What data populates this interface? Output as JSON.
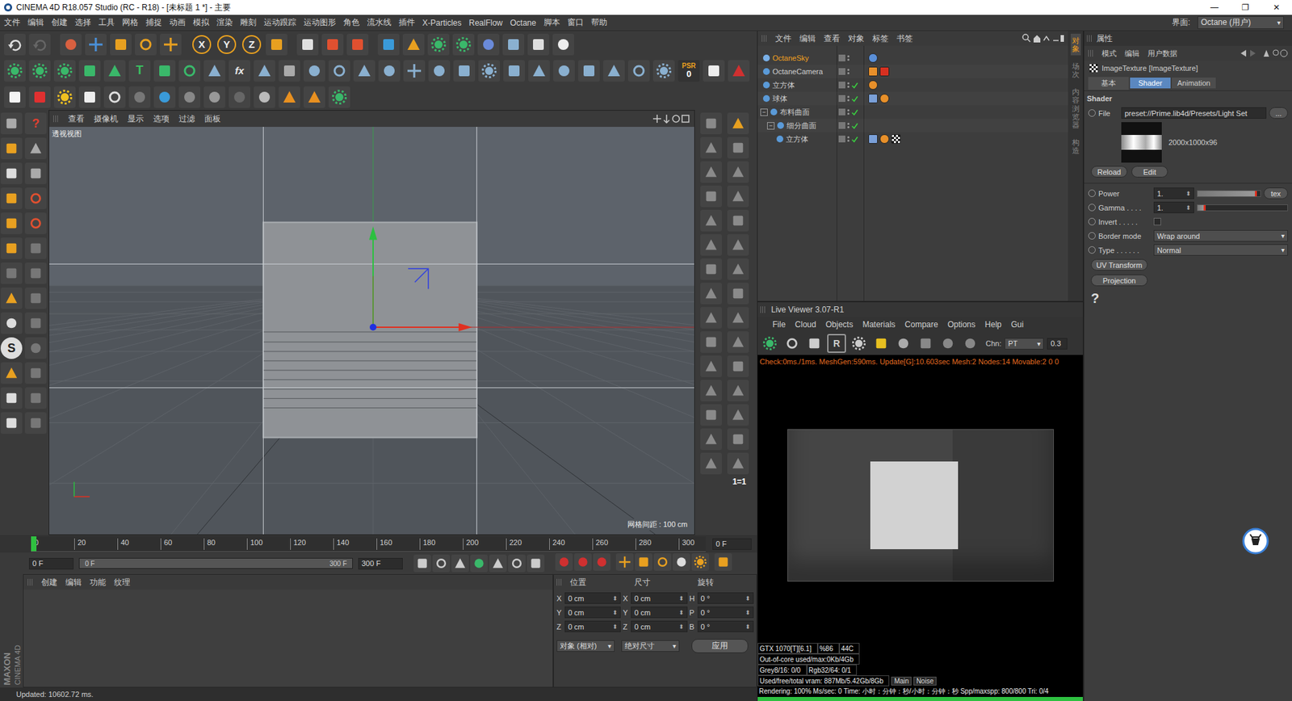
{
  "window": {
    "title": "CINEMA 4D R18.057 Studio (RC - R18) - [未标题 1 *] - 主要",
    "controls": [
      "—",
      "❐",
      "✕"
    ]
  },
  "menu": [
    "文件",
    "编辑",
    "创建",
    "选择",
    "工具",
    "网格",
    "捕捉",
    "动画",
    "模拟",
    "渲染",
    "雕刻",
    "运动跟踪",
    "运动图形",
    "角色",
    "流水线",
    "插件",
    "X-Particles",
    "RealFlow",
    "Octane",
    "脚本",
    "窗口",
    "帮助"
  ],
  "layout": {
    "label": "界面:",
    "value": "Octane (用户)"
  },
  "toolbar": {
    "axes": [
      "X",
      "Y",
      "Z"
    ],
    "text_tool": "T",
    "fx": "fx",
    "psr": "PSR",
    "psr_value": "0"
  },
  "left_tools": {
    "help": "?",
    "snap": "S"
  },
  "viewport": {
    "menu": [
      "查看",
      "摄像机",
      "显示",
      "选项",
      "过滤",
      "面板"
    ],
    "label": "透视视图",
    "grid": "网格间距 : 100 cm",
    "scale_badge": "1=1"
  },
  "timeline": {
    "ticks": [
      "0",
      "20",
      "40",
      "60",
      "80",
      "100",
      "120",
      "140",
      "160",
      "180",
      "200",
      "220",
      "240",
      "260",
      "280",
      "300"
    ],
    "level": 0,
    "frame": "0 F"
  },
  "transport": {
    "start": "0 F",
    "slider_start": "0 F",
    "slider_end": "300 F",
    "end": "300 F"
  },
  "materials": {
    "menu": [
      "创建",
      "编辑",
      "功能",
      "纹理"
    ],
    "logo_top": "MAXON",
    "logo_bottom": "CINEMA 4D"
  },
  "coords": {
    "headers": [
      "位置",
      "尺寸",
      "旋转"
    ],
    "rows": [
      {
        "a": "X",
        "pos": "0 cm",
        "b": "X",
        "size": "0 cm",
        "c": "H",
        "rot": "0 °"
      },
      {
        "a": "Y",
        "pos": "0 cm",
        "b": "Y",
        "size": "0 cm",
        "c": "P",
        "rot": "0 °"
      },
      {
        "a": "Z",
        "pos": "0 cm",
        "b": "Z",
        "size": "0 cm",
        "c": "B",
        "rot": "0 °"
      }
    ],
    "mode": "对象 (相对)",
    "size_mode": "绝对尺寸",
    "apply": "应用"
  },
  "status": "Updated: 10602.72 ms.",
  "objects": {
    "menu": [
      "文件",
      "编辑",
      "查看",
      "对象",
      "标签",
      "书签"
    ],
    "rows": [
      {
        "name": "OctaneSky",
        "depth": 0,
        "has_children": false,
        "expanded": false,
        "selected": true,
        "enabled": false,
        "tags": [
          "sky"
        ]
      },
      {
        "name": "OctaneCamera",
        "depth": 0,
        "has_children": false,
        "expanded": false,
        "selected": false,
        "enabled": false,
        "tags": [
          "protect",
          "camera"
        ]
      },
      {
        "name": "立方体",
        "depth": 0,
        "has_children": false,
        "expanded": false,
        "selected": false,
        "enabled": true,
        "tags": [
          "material"
        ]
      },
      {
        "name": "球体",
        "depth": 0,
        "has_children": false,
        "expanded": false,
        "selected": false,
        "enabled": true,
        "tags": [
          "mesh",
          "material"
        ]
      },
      {
        "name": "布料曲面",
        "depth": 0,
        "has_children": true,
        "expanded": true,
        "selected": false,
        "enabled": true,
        "tags": []
      },
      {
        "name": "细分曲面",
        "depth": 1,
        "has_children": true,
        "expanded": true,
        "selected": false,
        "enabled": true,
        "tags": []
      },
      {
        "name": "立方体",
        "depth": 2,
        "has_children": false,
        "expanded": false,
        "selected": false,
        "enabled": true,
        "tags": [
          "phong",
          "material",
          "checker"
        ]
      }
    ]
  },
  "side_tabs": [
    {
      "label": "对象",
      "selected": true
    },
    {
      "label": "场次",
      "selected": false
    },
    {
      "label": "内容浏览器",
      "selected": false
    },
    {
      "label": "构造",
      "selected": false
    }
  ],
  "attributes": {
    "title": "属性",
    "menu": [
      "模式",
      "编辑",
      "用户数据"
    ],
    "object": "ImageTexture [ImageTexture]",
    "tabs": [
      {
        "label": "基本",
        "selected": false
      },
      {
        "label": "Shader",
        "selected": true
      },
      {
        "label": "Animation",
        "selected": false
      }
    ],
    "section": "Shader",
    "file_label": "File",
    "file_value": "preset://Prime.lib4d/Presets/Light Set",
    "file_button": "...",
    "thumb_size": "2000x1000x96",
    "buttons": [
      "Reload",
      "Edit"
    ],
    "params": [
      {
        "kind": "slider",
        "label": "Power",
        "value": "1.",
        "level": 0.95,
        "button": "tex"
      },
      {
        "kind": "slider",
        "label": "Gamma . . . .",
        "value": "1.",
        "level": 0.09,
        "button": ""
      },
      {
        "kind": "checkbox",
        "label": "Invert . . . . .",
        "checked": false
      },
      {
        "kind": "dropdown",
        "label": "Border mode",
        "value": "Wrap around"
      },
      {
        "kind": "dropdown",
        "label": "Type . . . . . .",
        "value": "Normal"
      }
    ],
    "extra_buttons": [
      "UV Transform",
      "Projection"
    ],
    "help": "?"
  },
  "live_viewer": {
    "title": "Live Viewer 3.07-R1",
    "menu": [
      "File",
      "Cloud",
      "Objects",
      "Materials",
      "Compare",
      "Options",
      "Help",
      "Gui"
    ],
    "glyph": "R",
    "chn_label": "Chn:",
    "chn_value": "PT",
    "value": "0.3",
    "check_line": "Check:0ms./1ms. MeshGen:590ms. Update[G]:10.603sec Mesh:2 Nodes:14 Movable:2  0 0",
    "stats": [
      [
        "GTX 1070[T][6.1]",
        "%86",
        "44C"
      ],
      [
        "Out-of-core used/max:0Kb/4Gb"
      ],
      [
        "Grey8/16: 0/0",
        "Rgb32/64: 0/1"
      ],
      [
        "Used/free/total vram: 887Mb/5.42Gb/8Gb"
      ]
    ],
    "stat_tabs": [
      "Main",
      "Noise"
    ],
    "rendering": "Rendering: 100%   Ms/sec: 0   Time: 小时：分钟：秒/小时：分钟：秒   Spp/maxspp: 800/800   Tri: 0/4",
    "level": 1
  }
}
